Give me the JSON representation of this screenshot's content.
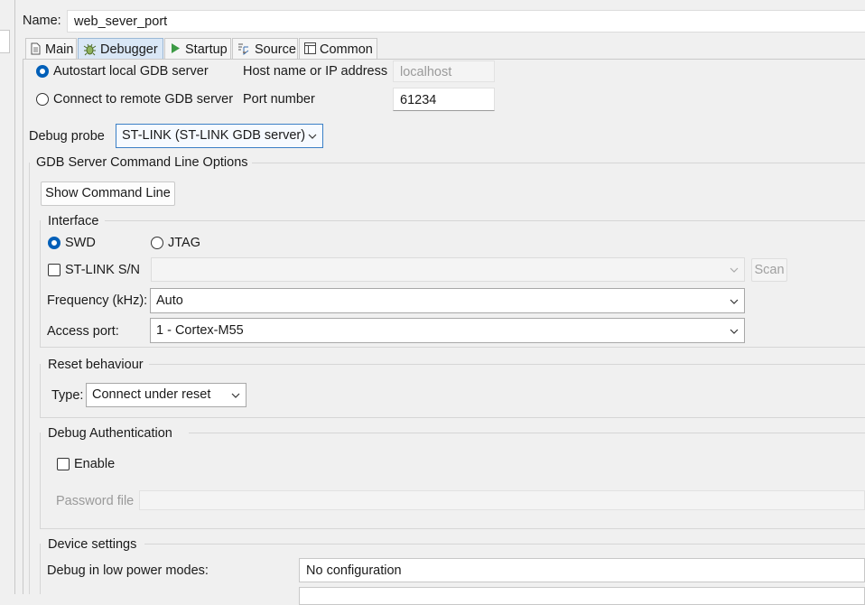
{
  "name": {
    "label": "Name:",
    "value": "web_sever_port"
  },
  "tabs": [
    {
      "label": "Main",
      "icon": "document-icon"
    },
    {
      "label": "Debugger",
      "icon": "bug-icon"
    },
    {
      "label": "Startup",
      "icon": "play-icon"
    },
    {
      "label": "Source",
      "icon": "source-icon"
    },
    {
      "label": "Common",
      "icon": "window-icon"
    }
  ],
  "gdb": {
    "autostart_label": "Autostart local GDB server",
    "remote_label": "Connect to remote GDB server",
    "host_label": "Host name or IP address",
    "host_value": "localhost",
    "port_label": "Port number",
    "port_value": "61234"
  },
  "probe": {
    "label": "Debug probe",
    "value": "ST-LINK (ST-LINK GDB server)"
  },
  "server": {
    "title": "GDB Server Command Line Options",
    "show_cmd_label": "Show Command Line"
  },
  "interface": {
    "title": "Interface",
    "swd_label": "SWD",
    "jtag_label": "JTAG",
    "stlink_sn_label": "ST-LINK S/N",
    "stlink_sn_value": "",
    "scan_label": "Scan",
    "frequency_label": "Frequency (kHz):",
    "frequency_value": "Auto",
    "access_port_label": "Access port:",
    "access_port_value": "1 - Cortex-M55"
  },
  "reset": {
    "title": "Reset behaviour",
    "type_label": "Type:",
    "type_value": "Connect under reset"
  },
  "auth": {
    "title": "Debug Authentication",
    "enable_label": "Enable",
    "password_label": "Password file"
  },
  "device": {
    "title": "Device settings",
    "low_power_label": "Debug in low power modes:",
    "low_power_value": "No configuration"
  },
  "colors": {
    "accent": "#005fb8",
    "active_tab": "#d9e7f6"
  }
}
